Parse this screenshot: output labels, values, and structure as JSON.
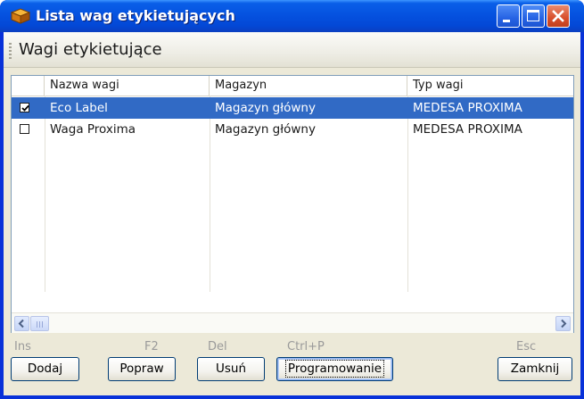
{
  "window": {
    "title": "Lista wag etykietujących",
    "app_icon": "box-icon",
    "controls": [
      "minimize-icon",
      "maximize-icon",
      "close-icon"
    ],
    "colors": {
      "titlebar": "#0552e0",
      "selection": "#316ac5",
      "close": "#d84f2c"
    }
  },
  "toolbar": {
    "title": "Wagi etykietujące"
  },
  "grid": {
    "columns": [
      "Nazwa wagi",
      "Magazyn",
      "Typ wagi"
    ],
    "rows": [
      {
        "checked": true,
        "selected": true,
        "name": "Eco Label",
        "warehouse": "Magazyn główny",
        "type": "MEDESA PROXIMA"
      },
      {
        "checked": false,
        "selected": false,
        "name": "Waga Proxima",
        "warehouse": "Magazyn główny",
        "type": "MEDESA PROXIMA"
      }
    ]
  },
  "actions": {
    "add": {
      "shortcut": "Ins",
      "label": "Dodaj"
    },
    "edit": {
      "shortcut": "F2",
      "label": "Popraw"
    },
    "delete": {
      "shortcut": "Del",
      "label": "Usuń"
    },
    "program": {
      "shortcut": "Ctrl+P",
      "label": "Programowanie"
    },
    "close": {
      "shortcut": "Esc",
      "label": "Zamknij"
    }
  }
}
